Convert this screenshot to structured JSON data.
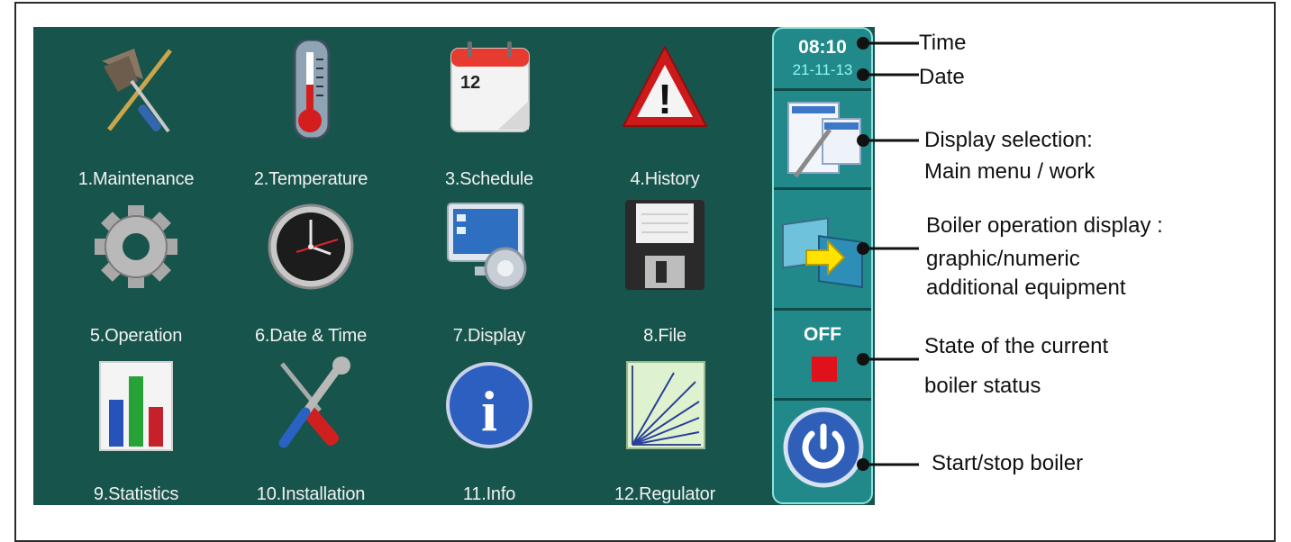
{
  "menu": {
    "items": [
      {
        "label": "1.Maintenance",
        "icon": "broom-screwdriver-icon"
      },
      {
        "label": "2.Temperature",
        "icon": "thermometer-icon"
      },
      {
        "label": "3.Schedule",
        "icon": "calendar-icon",
        "calendar_day": "12"
      },
      {
        "label": "4.History",
        "icon": "warning-icon",
        "mark": "!"
      },
      {
        "label": "5.Operation",
        "icon": "gear-icon"
      },
      {
        "label": "6.Date & Time",
        "icon": "clock-icon"
      },
      {
        "label": "7.Display",
        "icon": "monitor-gear-icon"
      },
      {
        "label": "8.File",
        "icon": "floppy-disk-icon"
      },
      {
        "label": "9.Statistics",
        "icon": "bar-chart-icon"
      },
      {
        "label": "10.Installation",
        "icon": "wrench-screwdriver-icon"
      },
      {
        "label": "11.Info",
        "icon": "info-icon",
        "mark": "i"
      },
      {
        "label": "12.Regulator",
        "icon": "regulator-graph-icon"
      }
    ]
  },
  "sidebar": {
    "time": "08:10",
    "date": "21-11-13",
    "boiler_state": "OFF",
    "state_color": "#e0111a"
  },
  "annotations": {
    "time": "Time",
    "date": "Date",
    "display_selection_1": "Display selection:",
    "display_selection_2": "Main menu / work",
    "boiler_display_1": "Boiler operation display :",
    "boiler_display_2": "graphic/numeric",
    "boiler_display_3": "additional equipment",
    "state_1": "State of the current",
    "state_2": "boiler status",
    "start_stop": "Start/stop boiler"
  },
  "colors": {
    "screen_background": "#17544b",
    "sidebar_background": "#22898a",
    "sidebar_border": "#8fe1de"
  }
}
